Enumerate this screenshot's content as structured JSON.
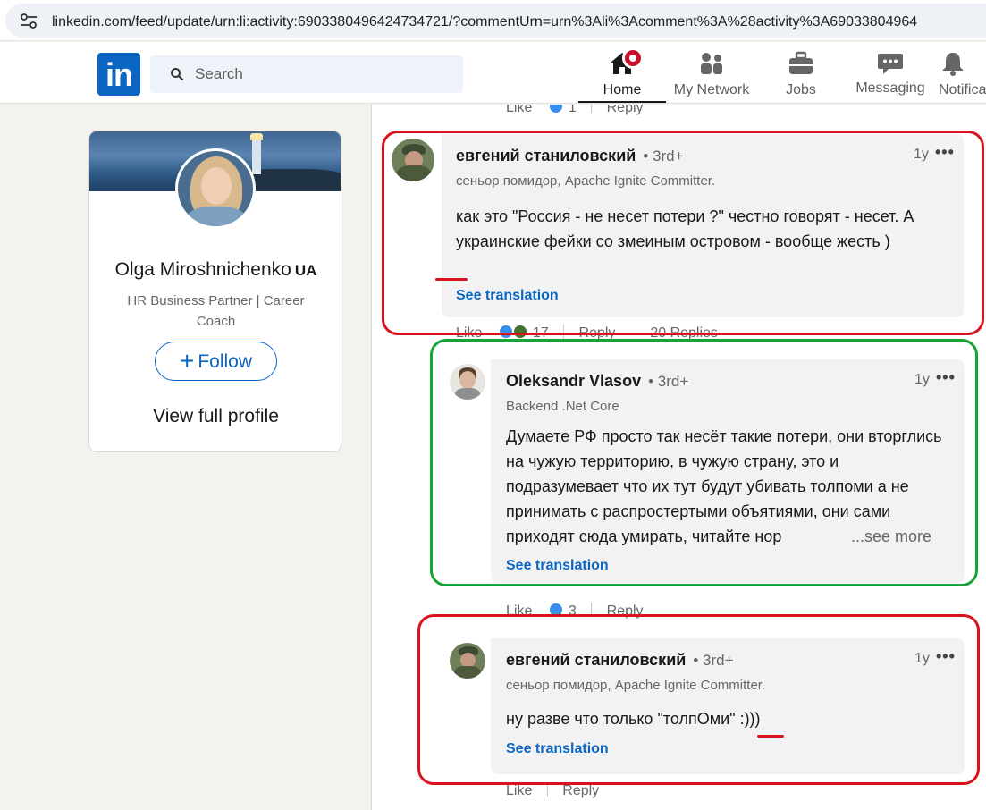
{
  "browser": {
    "url": "linkedin.com/feed/update/urn:li:activity:6903380496424734721/?commentUrn=urn%3Ali%3Acomment%3A%28activity%3A69033804964"
  },
  "header": {
    "logo": "in",
    "search_placeholder": "Search",
    "nav": {
      "home": "Home",
      "network": "My Network",
      "jobs": "Jobs",
      "messaging": "Messaging",
      "notifications": "Notifica"
    }
  },
  "profile": {
    "name": "Olga Miroshnichenko",
    "flag": "UA",
    "headline": "HR Business Partner | Career Coach",
    "follow_label": "Follow",
    "view_profile": "View full profile"
  },
  "top_actions": {
    "like": "Like",
    "count": "1",
    "reply": "Reply"
  },
  "comments": [
    {
      "name": "евгений станиловский",
      "degree": "• 3rd+",
      "time": "1y",
      "headline": "сеньор помидор, Apache Ignite Committer.",
      "text": "как это \"Россия - не несет потери ?\" честно говорят - несет. А украинские фейки со змеиным островом - вообще жесть )",
      "translate": "See translation",
      "actions": {
        "like": "Like",
        "count": "17",
        "reply": "Reply",
        "replies": "20 Replies"
      }
    },
    {
      "name": "Oleksandr Vlasov",
      "degree": "• 3rd+",
      "time": "1y",
      "headline": "Backend .Net Core",
      "text": "Думаете РФ просто так несёт такие потери, они вторглись на чужую территорию, в чужую страну, это и подразумевает что их тут будут убивать толпоми а не принимать с распростертыми объятиями, они сами приходят сюда умирать, читайте нор",
      "see_more": "...see more",
      "translate": "See translation",
      "actions": {
        "like": "Like",
        "count": "3",
        "reply": "Reply"
      }
    },
    {
      "name": "евгений станиловский",
      "degree": "• 3rd+",
      "time": "1y",
      "headline": "сеньор помидор, Apache Ignite Committer.",
      "text": "ну разве что только \"толпОми\" :)))",
      "translate": "See translation",
      "actions": {
        "like": "Like",
        "reply": "Reply"
      }
    }
  ],
  "colors": {
    "brand": "#0a66c2",
    "annotation_red": "#d9141f",
    "annotation_green": "#18a334",
    "notification": "#cb112d"
  }
}
